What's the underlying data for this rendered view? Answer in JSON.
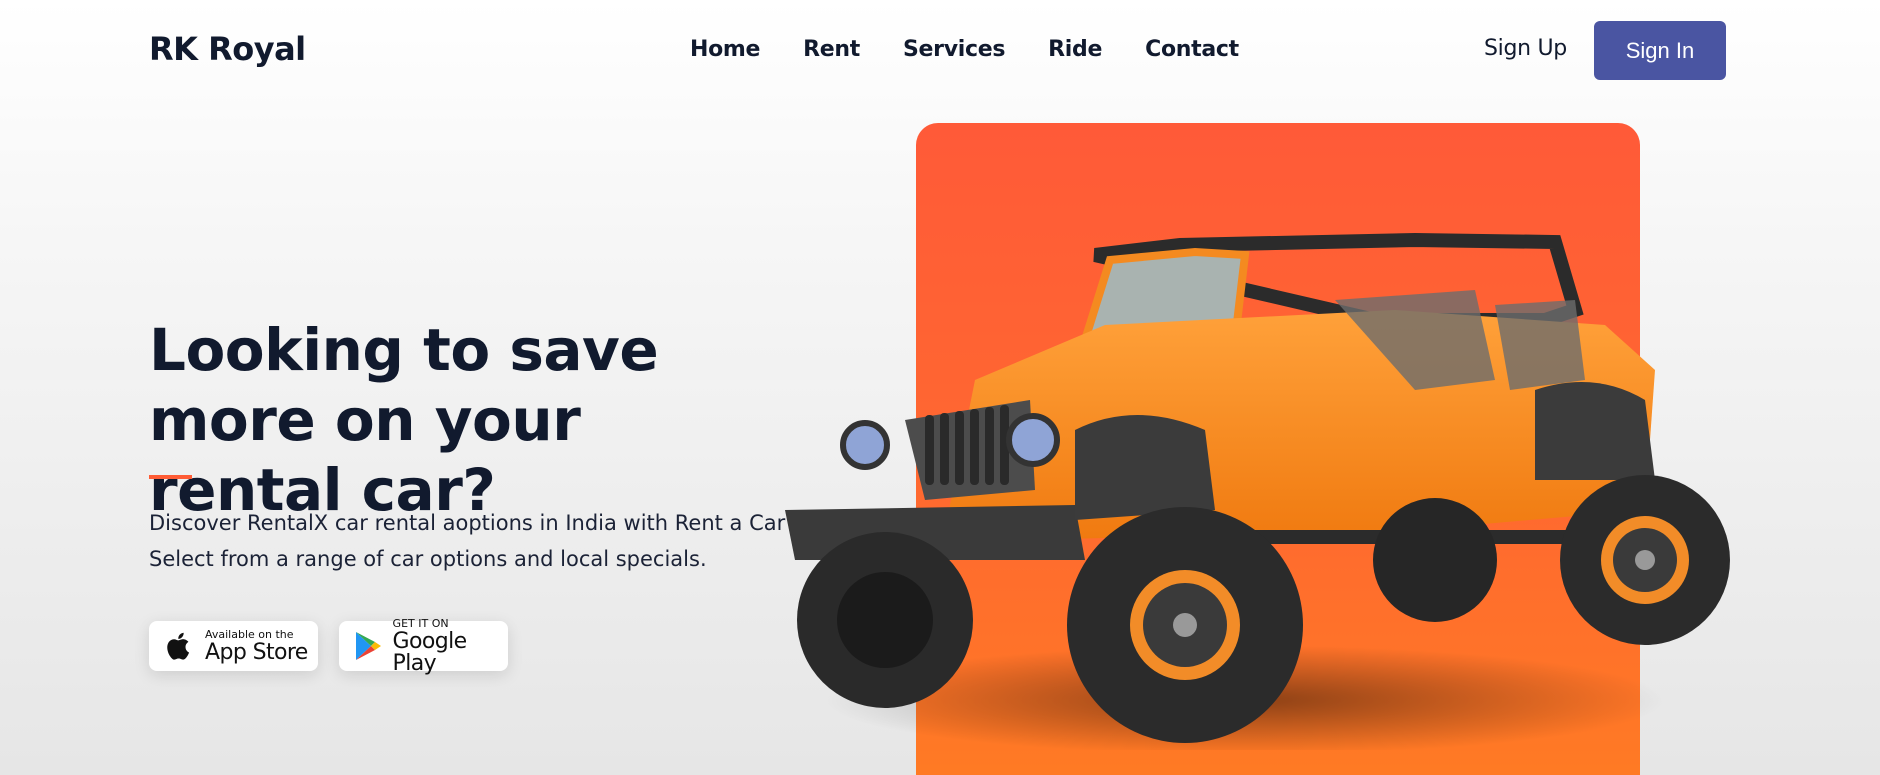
{
  "brand": {
    "name": "RK Royal"
  },
  "nav": {
    "items": [
      "Home",
      "Rent",
      "Services",
      "Ride",
      "Contact"
    ]
  },
  "auth": {
    "signup_label": "Sign Up",
    "signin_label": "Sign In"
  },
  "hero": {
    "heading": "Looking to save more on your rental car?",
    "description_line1": "Discover RentalX car rental aoptions in India with Rent a Car",
    "description_line2": "Select from a range of car options and local specials."
  },
  "stores": {
    "apple": {
      "small": "Available on the",
      "big": "App Store",
      "icon": "apple-icon"
    },
    "google": {
      "small": "GET IT ON",
      "big": "Google Play",
      "icon": "google-play-icon"
    }
  },
  "colors": {
    "accent": "#ff5c35",
    "primary_button": "#4a55a2",
    "hero_card": "#ff5a38",
    "text": "#111a2e"
  }
}
